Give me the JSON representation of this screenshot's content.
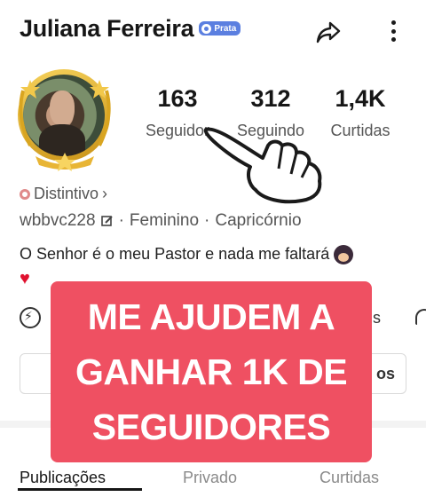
{
  "header": {
    "name": "Juliana Ferreira",
    "badge_label": "Prata"
  },
  "stats": [
    {
      "value": "163",
      "label": "Seguidor"
    },
    {
      "value": "312",
      "label": "Seguindo"
    },
    {
      "value": "1,4K",
      "label": "Curtidas"
    }
  ],
  "profile": {
    "distintivo_label": "Distintivo",
    "distintivo_chevron": "›",
    "username": "wbbvc228",
    "gender": "Feminino",
    "sign": "Capricórnio",
    "separator": "·",
    "bio": "O Senhor é o meu Pastor e nada me faltará",
    "bio_heart": "♥"
  },
  "row": {
    "partial_label": "s"
  },
  "action_bar": {
    "partial_label": "os"
  },
  "banner": {
    "lines": [
      "ME AJUDEM A",
      "GANHAR 1K DE",
      "SEGUIDORES"
    ],
    "color": "#ef5062"
  },
  "tabs": [
    {
      "label": "Publicações",
      "active": true
    },
    {
      "label": "Privado",
      "active": false
    },
    {
      "label": "Curtidas",
      "active": false
    }
  ],
  "icons": {
    "share": "share-icon",
    "more": "more-icon",
    "edit": "edit-icon",
    "bolt": "bolt-icon",
    "tag": "tag-icon"
  }
}
